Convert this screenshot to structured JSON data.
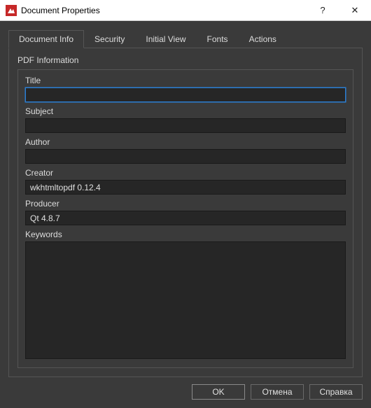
{
  "window": {
    "title": "Document Properties",
    "help_symbol": "?",
    "close_symbol": "✕"
  },
  "tabs": {
    "document_info": "Document Info",
    "security": "Security",
    "initial_view": "Initial View",
    "fonts": "Fonts",
    "actions": "Actions"
  },
  "section": {
    "header": "PDF Information"
  },
  "fields": {
    "title": {
      "label": "Title",
      "value": ""
    },
    "subject": {
      "label": "Subject",
      "value": ""
    },
    "author": {
      "label": "Author",
      "value": ""
    },
    "creator": {
      "label": "Creator",
      "value": "wkhtmltopdf 0.12.4"
    },
    "producer": {
      "label": "Producer",
      "value": "Qt 4.8.7"
    },
    "keywords": {
      "label": "Keywords",
      "value": ""
    }
  },
  "buttons": {
    "ok": "OK",
    "cancel": "Отмена",
    "help": "Справка"
  }
}
